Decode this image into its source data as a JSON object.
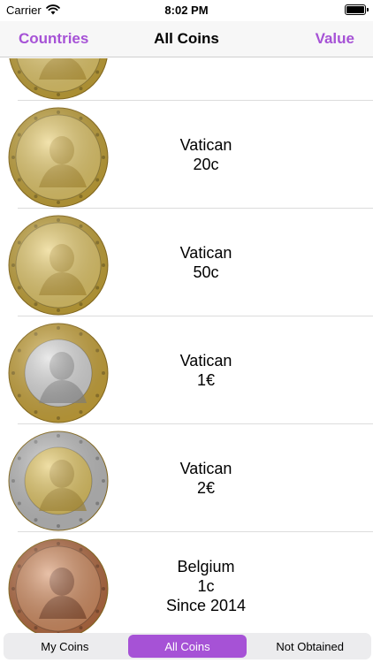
{
  "status": {
    "carrier": "Carrier",
    "time": "8:02 PM"
  },
  "nav": {
    "left": "Countries",
    "title": "All Coins",
    "right": "Value"
  },
  "accent": "#a652d6",
  "coins": [
    {
      "lines": [
        "",
        "",
        ""
      ],
      "metal": "gold",
      "icon": "vatican-10c-coin"
    },
    {
      "lines": [
        "Vatican",
        "20c",
        ""
      ],
      "metal": "gold",
      "icon": "vatican-20c-coin"
    },
    {
      "lines": [
        "Vatican",
        "50c",
        ""
      ],
      "metal": "gold",
      "icon": "vatican-50c-coin"
    },
    {
      "lines": [
        "Vatican",
        "1€",
        ""
      ],
      "metal": "bimetal-silver-center",
      "icon": "vatican-1euro-coin"
    },
    {
      "lines": [
        "Vatican",
        "2€",
        ""
      ],
      "metal": "bimetal-gold-center",
      "icon": "vatican-2euro-coin"
    },
    {
      "lines": [
        "Belgium",
        "1c",
        "Since 2014"
      ],
      "metal": "copper",
      "icon": "belgium-1c-coin"
    }
  ],
  "segments": {
    "items": [
      "My Coins",
      "All Coins",
      "Not Obtained"
    ],
    "selected": "All Coins"
  }
}
